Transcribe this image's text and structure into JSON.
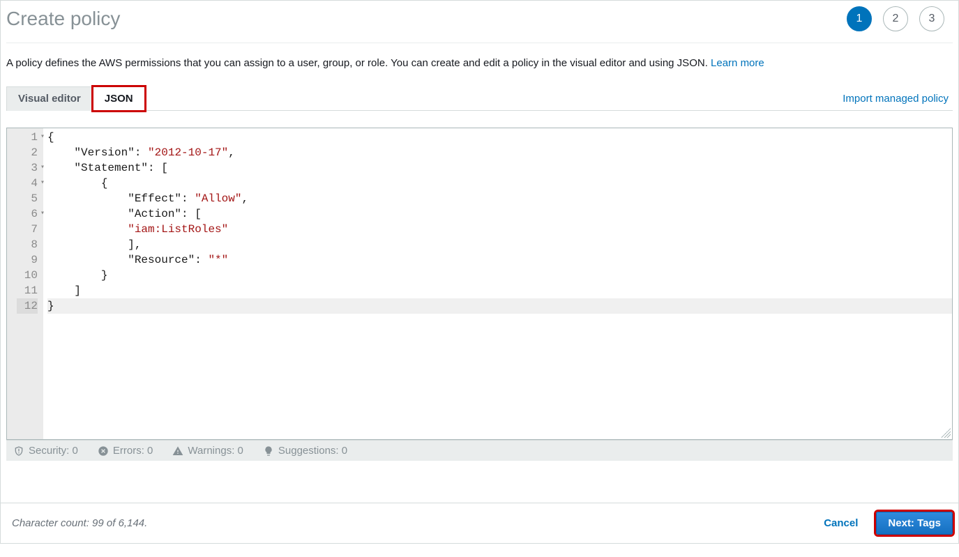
{
  "header": {
    "title": "Create policy",
    "steps": [
      "1",
      "2",
      "3"
    ],
    "active_step": 0
  },
  "description": {
    "text": "A policy defines the AWS permissions that you can assign to a user, group, or role. You can create and edit a policy in the visual editor and using JSON. ",
    "link_text": "Learn more"
  },
  "tabs": {
    "visual_editor": "Visual editor",
    "json": "JSON",
    "import_link": "Import managed policy"
  },
  "editor": {
    "lines": [
      {
        "num": "1",
        "fold": true,
        "active": false,
        "tokens": [
          {
            "t": "{",
            "c": "punc"
          }
        ]
      },
      {
        "num": "2",
        "fold": false,
        "active": false,
        "tokens": [
          {
            "t": "    ",
            "c": ""
          },
          {
            "t": "\"Version\"",
            "c": "key"
          },
          {
            "t": ": ",
            "c": "punc"
          },
          {
            "t": "\"2012-10-17\"",
            "c": "str"
          },
          {
            "t": ",",
            "c": "punc"
          }
        ]
      },
      {
        "num": "3",
        "fold": true,
        "active": false,
        "tokens": [
          {
            "t": "    ",
            "c": ""
          },
          {
            "t": "\"Statement\"",
            "c": "key"
          },
          {
            "t": ": [",
            "c": "punc"
          }
        ]
      },
      {
        "num": "4",
        "fold": true,
        "active": false,
        "tokens": [
          {
            "t": "        {",
            "c": "punc"
          }
        ]
      },
      {
        "num": "5",
        "fold": false,
        "active": false,
        "tokens": [
          {
            "t": "            ",
            "c": ""
          },
          {
            "t": "\"Effect\"",
            "c": "key"
          },
          {
            "t": ": ",
            "c": "punc"
          },
          {
            "t": "\"Allow\"",
            "c": "str"
          },
          {
            "t": ",",
            "c": "punc"
          }
        ]
      },
      {
        "num": "6",
        "fold": true,
        "active": false,
        "tokens": [
          {
            "t": "            ",
            "c": ""
          },
          {
            "t": "\"Action\"",
            "c": "key"
          },
          {
            "t": ": [",
            "c": "punc"
          }
        ]
      },
      {
        "num": "7",
        "fold": false,
        "active": false,
        "tokens": [
          {
            "t": "            ",
            "c": ""
          },
          {
            "t": "\"iam:ListRoles\"",
            "c": "str"
          }
        ]
      },
      {
        "num": "8",
        "fold": false,
        "active": false,
        "tokens": [
          {
            "t": "            ],",
            "c": "punc"
          }
        ]
      },
      {
        "num": "9",
        "fold": false,
        "active": false,
        "tokens": [
          {
            "t": "            ",
            "c": ""
          },
          {
            "t": "\"Resource\"",
            "c": "key"
          },
          {
            "t": ": ",
            "c": "punc"
          },
          {
            "t": "\"*\"",
            "c": "str"
          }
        ]
      },
      {
        "num": "10",
        "fold": false,
        "active": false,
        "tokens": [
          {
            "t": "        }",
            "c": "punc"
          }
        ]
      },
      {
        "num": "11",
        "fold": false,
        "active": false,
        "tokens": [
          {
            "t": "    ]",
            "c": "punc"
          }
        ]
      },
      {
        "num": "12",
        "fold": false,
        "active": true,
        "tokens": [
          {
            "t": "}",
            "c": "punc"
          }
        ]
      }
    ]
  },
  "status": {
    "security": "Security: 0",
    "errors": "Errors: 0",
    "warnings": "Warnings: 0",
    "suggestions": "Suggestions: 0"
  },
  "footer": {
    "char_count": "Character count: 99 of 6,144.",
    "cancel": "Cancel",
    "next": "Next: Tags"
  }
}
